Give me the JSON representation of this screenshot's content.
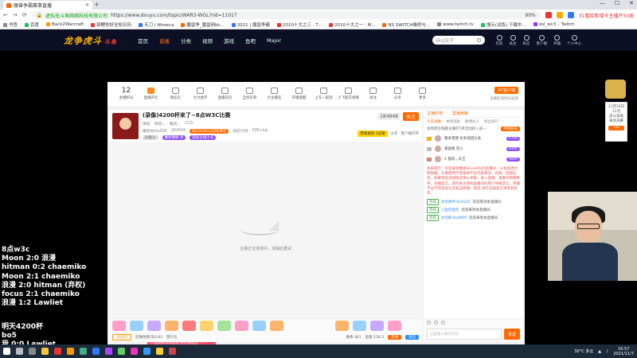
{
  "browser": {
    "tab_title": "魔兽争霸赛事直播",
    "url_host": "虚拟无斗鱼网络科技有限公司",
    "url_path": "https://www.douyu.com/topic/WAR3-WGL?rid=11017",
    "zoom": "90%",
    "ext_note": "31看给新增卡主播开50周",
    "window_controls": [
      "—",
      "☐",
      "✕"
    ]
  },
  "bookmarks": [
    "书签",
    "百度",
    "Back2Warcraft",
    "锦鲤你好全知日历",
    "天刀 | Afreeca",
    "魔兽争_魔兽网kk...",
    "2021 | 魔兽争霸",
    "2010十大之三 · T...",
    "2010十大之一 · M...",
    "NS SWITCH维修与...",
    "www.twitch.tv",
    "搜元(试炼)·下载中...",
    "esl_wc3 – Twitch"
  ],
  "site": {
    "logo": "龙争虎斗",
    "logo_sub": "斗鱼",
    "nav": [
      "首页",
      "直播",
      "分类",
      "视频",
      "游戏",
      "鱼吧",
      "Major"
    ],
    "search_placeholder": "ilkg说子",
    "user_icons": [
      "历史",
      "关注",
      "私信",
      "客户端",
      "开播",
      "个人中心"
    ]
  },
  "toolbar": {
    "items": [
      {
        "label": "主播积分",
        "value": "12"
      },
      {
        "label": "直播开元"
      },
      {
        "label": "微信礼"
      },
      {
        "label": "大力金环"
      },
      {
        "label": "直播日历"
      },
      {
        "label": "全民彩装"
      },
      {
        "label": "大主播任"
      },
      {
        "label": "开播提醒"
      },
      {
        "label": "上车一起玩"
      },
      {
        "label": "小飞船在线库"
      },
      {
        "label": "关注"
      },
      {
        "label": "分享"
      },
      {
        "label": "更多"
      }
    ],
    "pc_btn": "PC客户端",
    "pc_sub": "主播在线时长加速"
  },
  "room": {
    "title": "(录像)4200杯来了~8点W3C比赛",
    "meta": [
      "举报",
      "网络...",
      "魔兽...",
      "1/15"
    ],
    "streamer": "魔兽局Ivo000",
    "hot": "282604",
    "ranks": "WCGS2013冠军神吉",
    "followers": "排名行榜",
    "count": "595+kg",
    "tags": [
      "兴高人",
      "魔兽巅峰 周",
      "超级主播之名"
    ],
    "level": "45",
    "badge_follow": "184848",
    "follow_btn": "关注",
    "sub_links": [
      "周周活动",
      "分享",
      "客户端打开"
    ],
    "yellow": "西域城场 1竞猜"
  },
  "video": {
    "loading": "主播正在连线中，请稍后重试"
  },
  "tip": "主播发起抢礼物加成，可成为提升 - 用户面对积分并获得 抢礼物加成",
  "gifts": {
    "bar": [
      "【虎化】",
      "还剩你那/天0.83",
      "赞礼包",
      "剩余 481",
      "鱼翅 128.3",
      "充值",
      "背包"
    ],
    "charge": "充值",
    "pack": "背包"
  },
  "chat": {
    "tabs": [
      "主播红榜",
      "直播贡献"
    ],
    "subtabs": [
      "今日贡献",
      "本周贡献",
      "微博达人",
      "粉丝排行"
    ],
    "notice": "本周周在线看主播在5月活动的 | 前一",
    "notice_btn": "冲刺前前",
    "ranking": [
      {
        "name": "我未曾那 也有他回头处",
        "value": "5700"
      },
      {
        "name": "爱国者 风人",
        "value": "2000"
      },
      {
        "name": "2 怪的,,,天王",
        "value": "1600"
      }
    ],
    "system": "系统提示：欢迎来到魔兽局ivo000的直播间，斗鱼提倡文明观看，头像使用严禁吸纳不良内容政治、色情、低俗信息，如果发现违规情况请以举报，进入直播，请遵守网络秩序，主播禁言，请勿关注其他直播间的用户将被禁言，转播平台不得未经允许私自转播，如因 进行违规发言将受到处罚；",
    "lines": [
      {
        "lv": "等级",
        "name": "沐年依然 Bv0525",
        "msg": "欢迎来到本直播间"
      },
      {
        "lv": "等级",
        "name": "小鱼吃鱼吃",
        "msg": "欢迎来到本直播间"
      },
      {
        "lv": "等级",
        "name": "水烈侠 Bv0999",
        "msg": "欢迎来到本直播间"
      }
    ],
    "input_placeholder": "这里输入聊天内容",
    "send": "发送"
  },
  "side_card": [
    "11月16日",
    "12点",
    "虎斗高能",
    "来场决赛",
    "GO"
  ],
  "overlay_results": [
    "8点w3c",
    "Moon 2:0 浪漫",
    "hitman 0:2 chaemiko",
    "Moon 2:1 chaemiko",
    "浪漫  2:0 hitman (弃权)",
    "focus 2:1 chaemiko",
    "浪漫   1:2 Lawliet"
  ],
  "overlay_bottom": [
    "明天4200杯",
    "bo5",
    "我 0:0 Lawliet"
  ],
  "taskbar": {
    "weather": "30°C 多云",
    "time": "16:57",
    "date": "2021/11/7"
  }
}
